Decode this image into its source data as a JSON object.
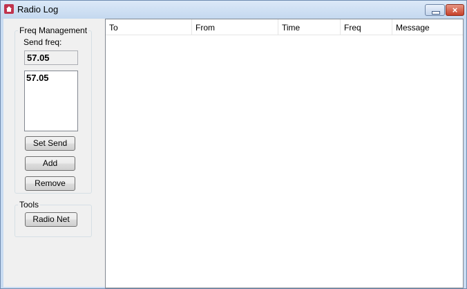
{
  "window": {
    "title": "Radio Log",
    "icon": "app-icon",
    "close_glyph": "×"
  },
  "freq_management": {
    "title": "Freq Management",
    "send_label": "Send freq:",
    "send_value": "57.05",
    "list_items": [
      "57.05"
    ],
    "buttons": {
      "set_send": "Set Send",
      "add": "Add",
      "remove": "Remove"
    }
  },
  "tools": {
    "title": "Tools",
    "radio_net": "Radio Net"
  },
  "log_table": {
    "columns": [
      "To",
      "From",
      "Time",
      "Freq",
      "Message"
    ],
    "rows": []
  }
}
